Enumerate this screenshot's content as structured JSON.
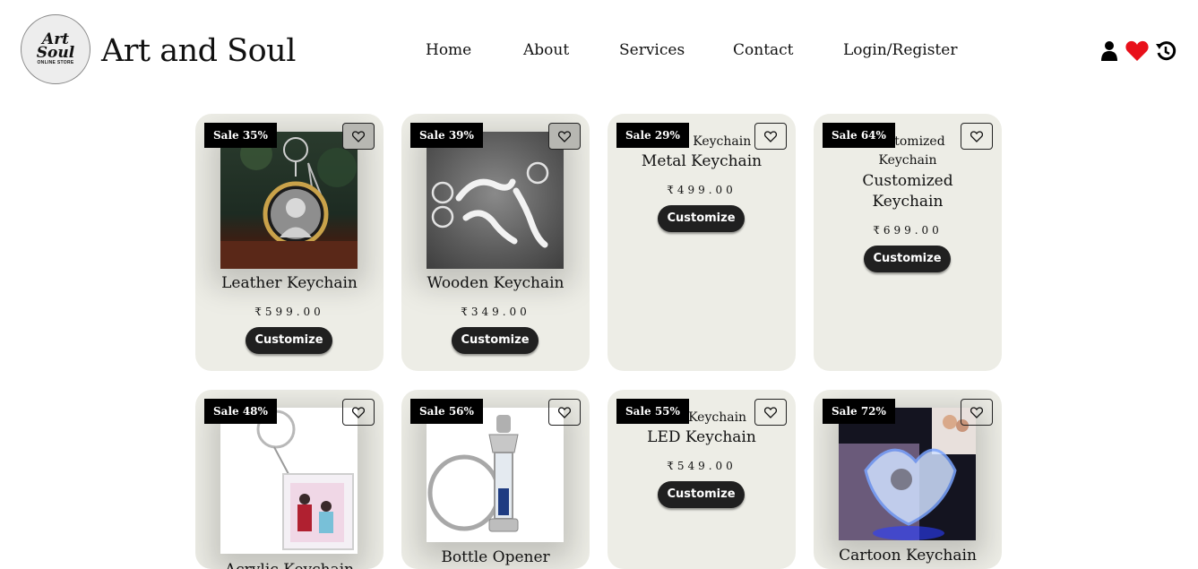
{
  "brand": {
    "logo_line1": "Art",
    "logo_line2": "Soul",
    "logo_line3": "ONLINE STORE",
    "name": "Art and Soul"
  },
  "nav": [
    "Home",
    "About",
    "Services",
    "Contact",
    "Login/Register"
  ],
  "header_icons": [
    "user-icon",
    "heart-icon",
    "history-icon"
  ],
  "colors": {
    "accent_heart": "#e8101a",
    "card_bg": "#ededE6",
    "button_bg": "#202020",
    "sale_bg": "#000000"
  },
  "products": [
    {
      "sale": "Sale 35%",
      "alt": "",
      "name": "Leather Keychain",
      "price": "₹599.00",
      "button": "Customize",
      "image": "circle-photo-keychain"
    },
    {
      "sale": "Sale 39%",
      "alt": "",
      "name": "Wooden Keychain",
      "price": "₹349.00",
      "button": "Customize",
      "image": "name-keychains"
    },
    {
      "sale": "Sale 29%",
      "alt": "Metal Keychain",
      "name": "Metal Keychain",
      "price": "₹499.00",
      "button": "Customize",
      "image": ""
    },
    {
      "sale": "Sale 64%",
      "alt": "Customized Keychain",
      "name": "Customized Keychain",
      "price": "₹699.00",
      "button": "Customize",
      "image": ""
    },
    {
      "sale": "Sale 48%",
      "alt": "",
      "name": "Acrylic Keychain",
      "price": "",
      "button": "",
      "image": "acrylic-couple-keychain"
    },
    {
      "sale": "Sale 56%",
      "alt": "",
      "name": "Bottle Opener",
      "price": "",
      "button": "",
      "image": "lantern-keychain"
    },
    {
      "sale": "Sale 55%",
      "alt": "LED Keychain",
      "name": "LED Keychain",
      "price": "₹549.00",
      "button": "Customize",
      "image": ""
    },
    {
      "sale": "Sale 72%",
      "alt": "",
      "name": "Cartoon Keychain",
      "price": "",
      "button": "",
      "image": "crystal-heart-keychain"
    }
  ]
}
